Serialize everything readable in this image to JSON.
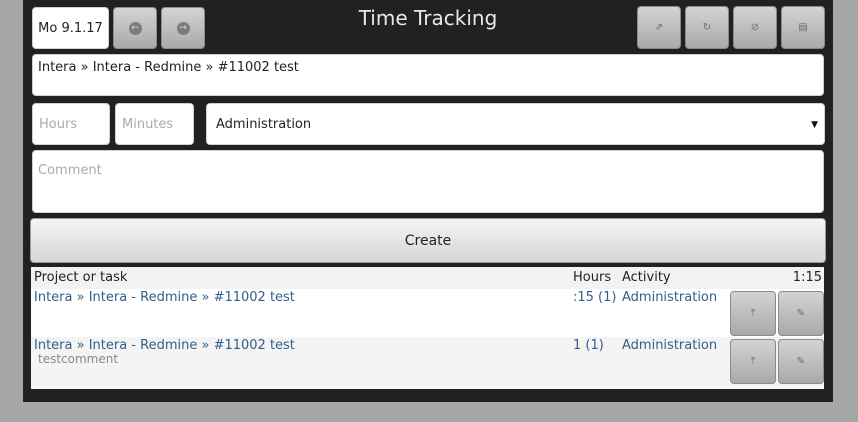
{
  "header": {
    "date": "Mo 9.1.17",
    "title": "Time Tracking",
    "prev_icon": "arrow-left-icon",
    "next_icon": "arrow-right-icon",
    "toolbar_icons": [
      "external-link-icon",
      "refresh-icon",
      "block-icon",
      "list-icon"
    ]
  },
  "form": {
    "task": "Intera » Intera - Redmine » #11002 test",
    "hours_placeholder": "Hours",
    "minutes_placeholder": "Minutes",
    "activity": "Administration",
    "comment_placeholder": "Comment",
    "create_label": "Create"
  },
  "table": {
    "headers": {
      "project": "Project or task",
      "hours": "Hours",
      "activity": "Activity",
      "total": "1:15"
    },
    "rows": [
      {
        "project": "Intera » Intera - Redmine » #11002 test",
        "comment": "",
        "hours": ":15 (1)",
        "activity": "Administration"
      },
      {
        "project": "Intera » Intera - Redmine » #11002 test",
        "comment": "testcomment",
        "hours": "1 (1)",
        "activity": "Administration"
      }
    ]
  },
  "colors": {
    "frame": "#212121",
    "link": "#2f5f8e",
    "outer_background": "#a6a6a6"
  }
}
